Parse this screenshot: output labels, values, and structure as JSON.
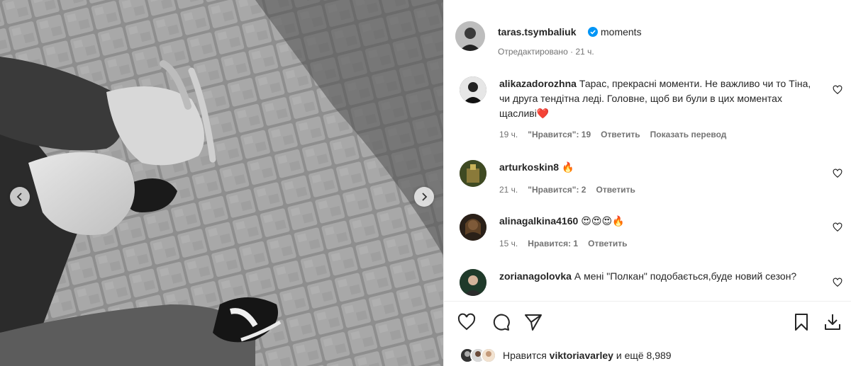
{
  "post": {
    "username": "taras.tsymbaliuk",
    "caption": "moments",
    "edited_label": "Отредактировано",
    "time": "21 ч."
  },
  "comments": [
    {
      "username": "alikazadorozhna",
      "text": "Тарас, прекрасні моменти. Не важливо чи то Тіна, чи друга тендітна леді. Головне, щоб ви були в цих моментах щасливі❤️",
      "time": "19 ч.",
      "likes": "\"Нравится\": 19",
      "reply": "Ответить",
      "translate": "Показать перевод"
    },
    {
      "username": "arturkoskin8",
      "text": "🔥",
      "time": "21 ч.",
      "likes": "\"Нравится\": 2",
      "reply": "Ответить"
    },
    {
      "username": "alinagalkina4160",
      "text": "😍😍😍🔥",
      "time": "15 ч.",
      "likes": "Нравится: 1",
      "reply": "Ответить"
    },
    {
      "username": "zorianagolovka",
      "text": "А мені \"Полкан\" подобається,буде новий сезон?"
    }
  ],
  "likes_bar": {
    "prefix": "Нравится",
    "user": "viktoriavarley",
    "suffix": "и ещё 8,989"
  },
  "colors": {
    "verified": "#0095f6",
    "text": "#262626",
    "muted": "#737373"
  },
  "icons": [
    "chevron-left-icon",
    "chevron-right-icon",
    "verified-badge-icon",
    "heart-icon",
    "comment-icon",
    "share-icon",
    "bookmark-icon",
    "download-icon"
  ]
}
